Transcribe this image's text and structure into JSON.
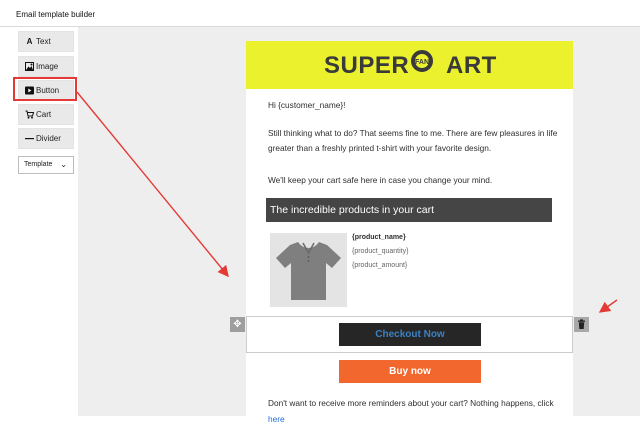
{
  "app": {
    "title": "Email template builder"
  },
  "sidebar": {
    "tools": [
      {
        "label": "Text",
        "icon": "text-icon"
      },
      {
        "label": "Image",
        "icon": "image-icon"
      },
      {
        "label": "Button",
        "icon": "button-icon"
      },
      {
        "label": "Cart",
        "icon": "cart-icon"
      },
      {
        "label": "Divider",
        "icon": "divider-icon"
      }
    ],
    "select": {
      "value": "Template"
    }
  },
  "email": {
    "logo": {
      "left": "SUPER",
      "circle": "FAN",
      "right": "ART"
    },
    "greeting": "Hi {customer_name}!",
    "paragraph1": "Still thinking what to do? That seems fine to me. There are few pleasures in life greater than a freshly printed t-shirt with your favorite design.",
    "paragraph2": "We'll keep your cart safe here in case you change your mind.",
    "products_title": "The incredible products in your cart",
    "product": {
      "name": "{product_name}",
      "quantity": "{product_quantity}",
      "amount": "{product_amount}"
    },
    "checkout_label": "Checkout Now",
    "buy_label": "Buy now",
    "footer_text": "Don't want to receive more reminders about your cart? Nothing happens, click ",
    "footer_link": "here"
  },
  "colors": {
    "logo_bg": "#ebf22d",
    "highlight": "#e53935",
    "checkout_bg": "#262626",
    "checkout_text": "#3b82c4",
    "buy_bg": "#f2672d",
    "products_title_bg": "#454545",
    "link": "#1e6fd9"
  }
}
